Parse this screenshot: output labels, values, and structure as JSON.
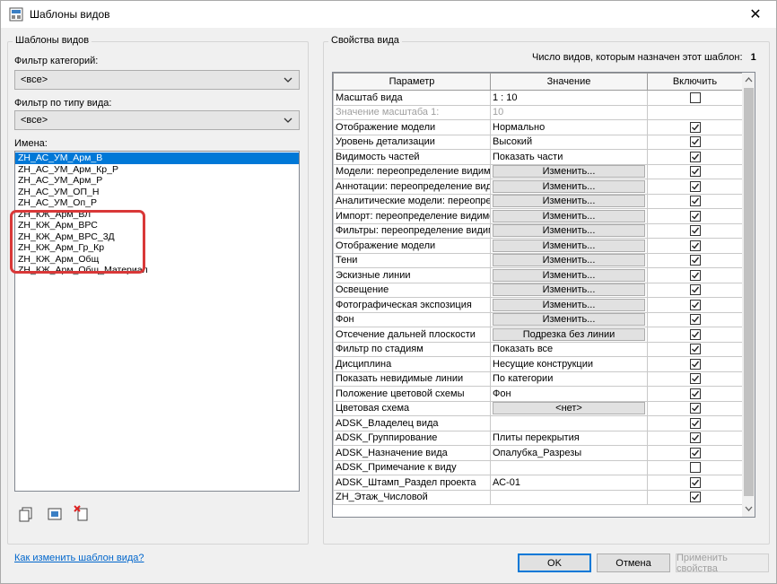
{
  "window": {
    "title": "Шаблоны видов",
    "close_glyph": "✕"
  },
  "left": {
    "group_title": "Шаблоны видов",
    "category_filter_label": "Фильтр категорий:",
    "category_filter_value": "<все>",
    "type_filter_label": "Фильтр по типу вида:",
    "type_filter_value": "<все>",
    "names_label": "Имена:",
    "names": [
      "ZH_АС_УМ_Арм_В",
      "ZH_АС_УМ_Арм_Кр_Р",
      "ZH_АС_УМ_Арм_Р",
      "ZH_АС_УМ_ОП_Н",
      "ZH_АС_УМ_Оп_Р",
      "ZH_КЖ_Арм_ВЛ",
      "ZH_КЖ_Арм_ВРС",
      "ZH_КЖ_Арм_ВРС_3Д",
      "ZH_КЖ_Арм_Гр_Кр",
      "ZH_КЖ_Арм_Общ",
      "ZH_КЖ_Арм_Общ_Материал"
    ],
    "selected_index": 0,
    "highlight_color": "#d93838",
    "help_link": "Как изменить шаблон вида?"
  },
  "right": {
    "group_title": "Свойства вида",
    "count_label": "Число видов, которым назначен этот шаблон:",
    "count_value": "1",
    "columns": [
      "Параметр",
      "Значение",
      "Включить"
    ],
    "rows": [
      {
        "param": "Масштаб вида",
        "value": "1 : 10",
        "kind": "text",
        "include": false,
        "disabled": false
      },
      {
        "param": "Значение масштаба   1:",
        "value": "10",
        "kind": "text",
        "include": null,
        "disabled": true
      },
      {
        "param": "Отображение модели",
        "value": "Нормально",
        "kind": "text",
        "include": true,
        "disabled": false
      },
      {
        "param": "Уровень детализации",
        "value": "Высокий",
        "kind": "text",
        "include": true,
        "disabled": false
      },
      {
        "param": "Видимость частей",
        "value": "Показать части",
        "kind": "text",
        "include": true,
        "disabled": false
      },
      {
        "param": "Модели: переопределение видимости",
        "value": "Изменить...",
        "kind": "button",
        "include": true,
        "disabled": false
      },
      {
        "param": "Аннотации: переопределение видимости",
        "value": "Изменить...",
        "kind": "button",
        "include": true,
        "disabled": false
      },
      {
        "param": "Аналитические модели: переопределение",
        "value": "Изменить...",
        "kind": "button",
        "include": true,
        "disabled": false
      },
      {
        "param": "Импорт: переопределение видимости",
        "value": "Изменить...",
        "kind": "button",
        "include": true,
        "disabled": false
      },
      {
        "param": "Фильтры: переопределение видимости",
        "value": "Изменить...",
        "kind": "button",
        "include": true,
        "disabled": false
      },
      {
        "param": "Отображение модели",
        "value": "Изменить...",
        "kind": "button",
        "include": true,
        "disabled": false
      },
      {
        "param": "Тени",
        "value": "Изменить...",
        "kind": "button",
        "include": true,
        "disabled": false
      },
      {
        "param": "Эскизные линии",
        "value": "Изменить...",
        "kind": "button",
        "include": true,
        "disabled": false
      },
      {
        "param": "Освещение",
        "value": "Изменить...",
        "kind": "button",
        "include": true,
        "disabled": false
      },
      {
        "param": "Фотографическая экспозиция",
        "value": "Изменить...",
        "kind": "button",
        "include": true,
        "disabled": false
      },
      {
        "param": "Фон",
        "value": "Изменить...",
        "kind": "button",
        "include": true,
        "disabled": false
      },
      {
        "param": "Отсечение дальней плоскости",
        "value": "Подрезка без линии",
        "kind": "button",
        "include": true,
        "disabled": false
      },
      {
        "param": "Фильтр по стадиям",
        "value": "Показать все",
        "kind": "text",
        "include": true,
        "disabled": false
      },
      {
        "param": "Дисциплина",
        "value": "Несущие конструкции",
        "kind": "text",
        "include": true,
        "disabled": false
      },
      {
        "param": "Показать невидимые линии",
        "value": "По категории",
        "kind": "text",
        "include": true,
        "disabled": false
      },
      {
        "param": "Положение цветовой схемы",
        "value": "Фон",
        "kind": "text",
        "include": true,
        "disabled": false
      },
      {
        "param": "Цветовая схема",
        "value": "<нет>",
        "kind": "button",
        "include": true,
        "disabled": false
      },
      {
        "param": "ADSK_Владелец вида",
        "value": "",
        "kind": "text",
        "include": true,
        "disabled": false
      },
      {
        "param": "ADSK_Группирование",
        "value": "Плиты перекрытия",
        "kind": "text",
        "include": true,
        "disabled": false
      },
      {
        "param": "ADSK_Назначение вида",
        "value": "Опалубка_Разрезы",
        "kind": "text",
        "include": true,
        "disabled": false
      },
      {
        "param": "ADSK_Примечание к виду",
        "value": "",
        "kind": "text",
        "include": false,
        "disabled": false
      },
      {
        "param": "ADSK_Штамп_Раздел проекта",
        "value": "АС-01",
        "kind": "text",
        "include": true,
        "disabled": false
      },
      {
        "param": "ZH_Этаж_Числовой",
        "value": "",
        "kind": "text",
        "include": true,
        "disabled": false
      }
    ]
  },
  "buttons": {
    "ok": "OK",
    "cancel": "Отмена",
    "apply": "Применить свойства"
  },
  "colors": {
    "accent": "#0078d7",
    "link": "#0066cc"
  }
}
